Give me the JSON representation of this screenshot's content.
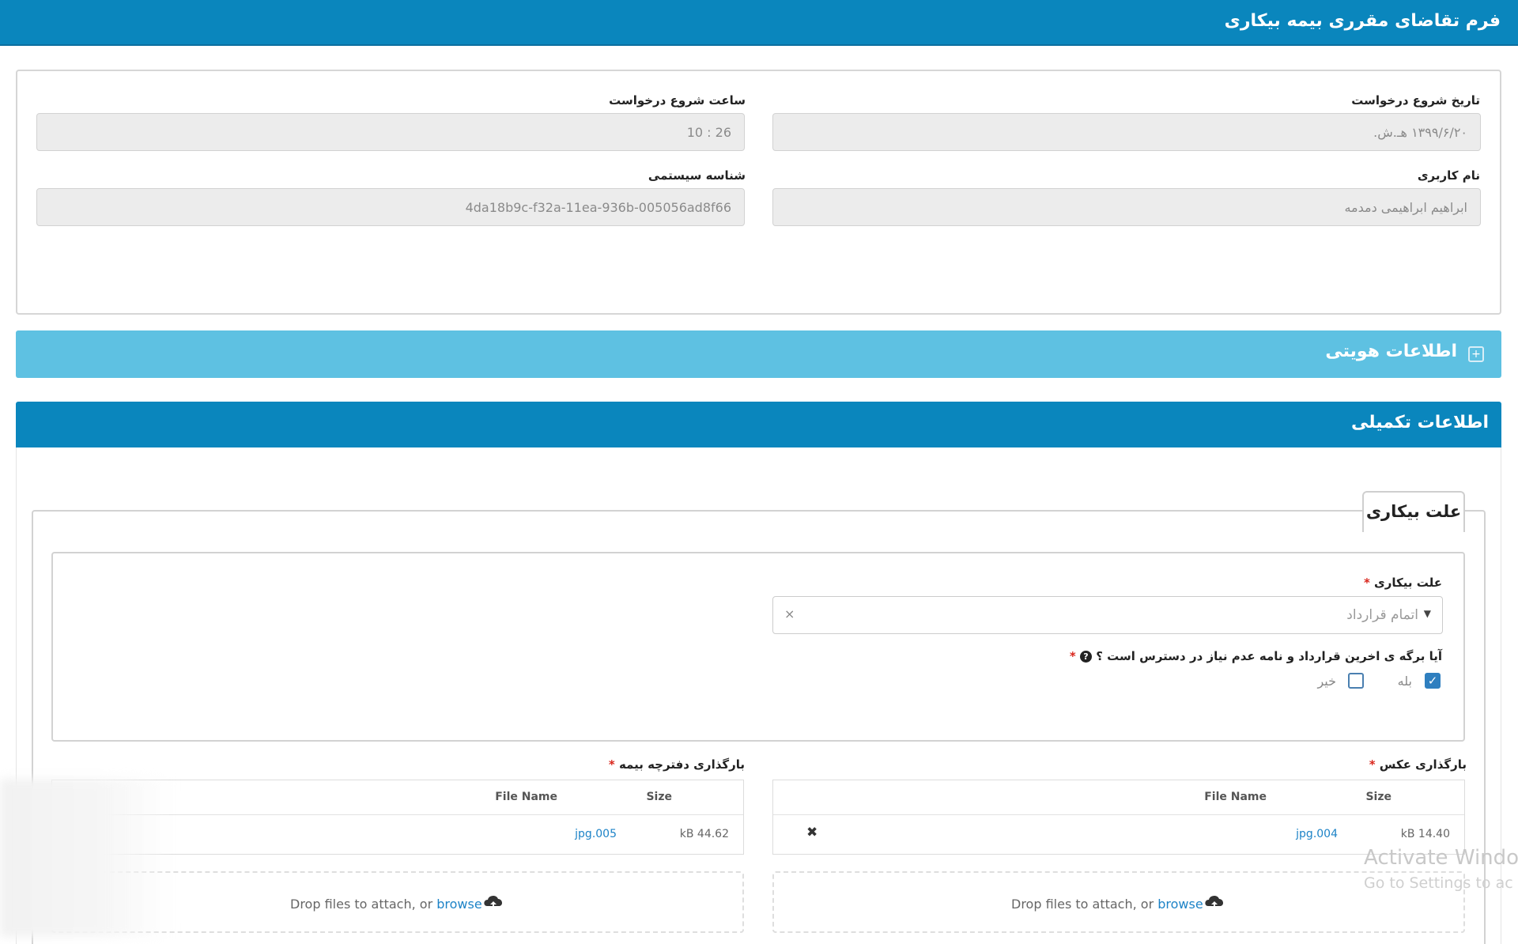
{
  "header": {
    "title": "فرم تقاضای مقرری بیمه بیکاری"
  },
  "request_info": {
    "start_date": {
      "label": "تاریخ شروع درخواست",
      "value": "۱۳۹۹/۶/۲۰ هـ.ش."
    },
    "start_time": {
      "label": "ساعت شروع درخواست",
      "value": "10 : 26"
    },
    "username": {
      "label": "نام کاربری",
      "value": "ابراهیم ابراهیمی دمدمه"
    },
    "system_id": {
      "label": "شناسه سیستمی",
      "value": "4da18b9c-f32a-11ea-936b-005056ad8f66"
    }
  },
  "identity_section": {
    "title": "اطلاعات هویتی",
    "expand_symbol": "+"
  },
  "supplementary_section": {
    "title": "اطلاعات تکمیلی",
    "fieldset_title": "علت بیکاری",
    "reason": {
      "label": "علت بیکاری",
      "required_mark": "*",
      "selected": "اتمام قرارداد",
      "clear_symbol": "×",
      "arrow_symbol": "▼"
    },
    "contract_question": {
      "label": "آیا برگه ی اخرین قرارداد و نامه عدم نیاز در دسترس است ؟",
      "info_symbol": "?",
      "required_mark": "*",
      "options": [
        {
          "label": "بله",
          "checked": true,
          "check_symbol": "✓"
        },
        {
          "label": "خیر",
          "checked": false
        }
      ]
    }
  },
  "uploads": {
    "photo": {
      "label": "بارگذاری عکس",
      "required_mark": "*",
      "columns": {
        "size": "Size",
        "file_name": "File Name"
      },
      "file": {
        "name": "jpg.004",
        "size": "kB 14.40"
      },
      "remove_symbol": "✖",
      "dropzone": {
        "text": "Drop files to attach, or",
        "browse": "browse"
      }
    },
    "booklet": {
      "label": "بارگذاری دفترچه بیمه",
      "required_mark": "*",
      "columns": {
        "size": "Size",
        "file_name": "File Name"
      },
      "file": {
        "name": "jpg.005",
        "size": "kB 44.62"
      },
      "dropzone": {
        "text": "Drop files to attach, or",
        "browse": "browse"
      }
    }
  },
  "watermark": {
    "line1": "Activate Windo",
    "line2": "Go to Settings to ac"
  }
}
